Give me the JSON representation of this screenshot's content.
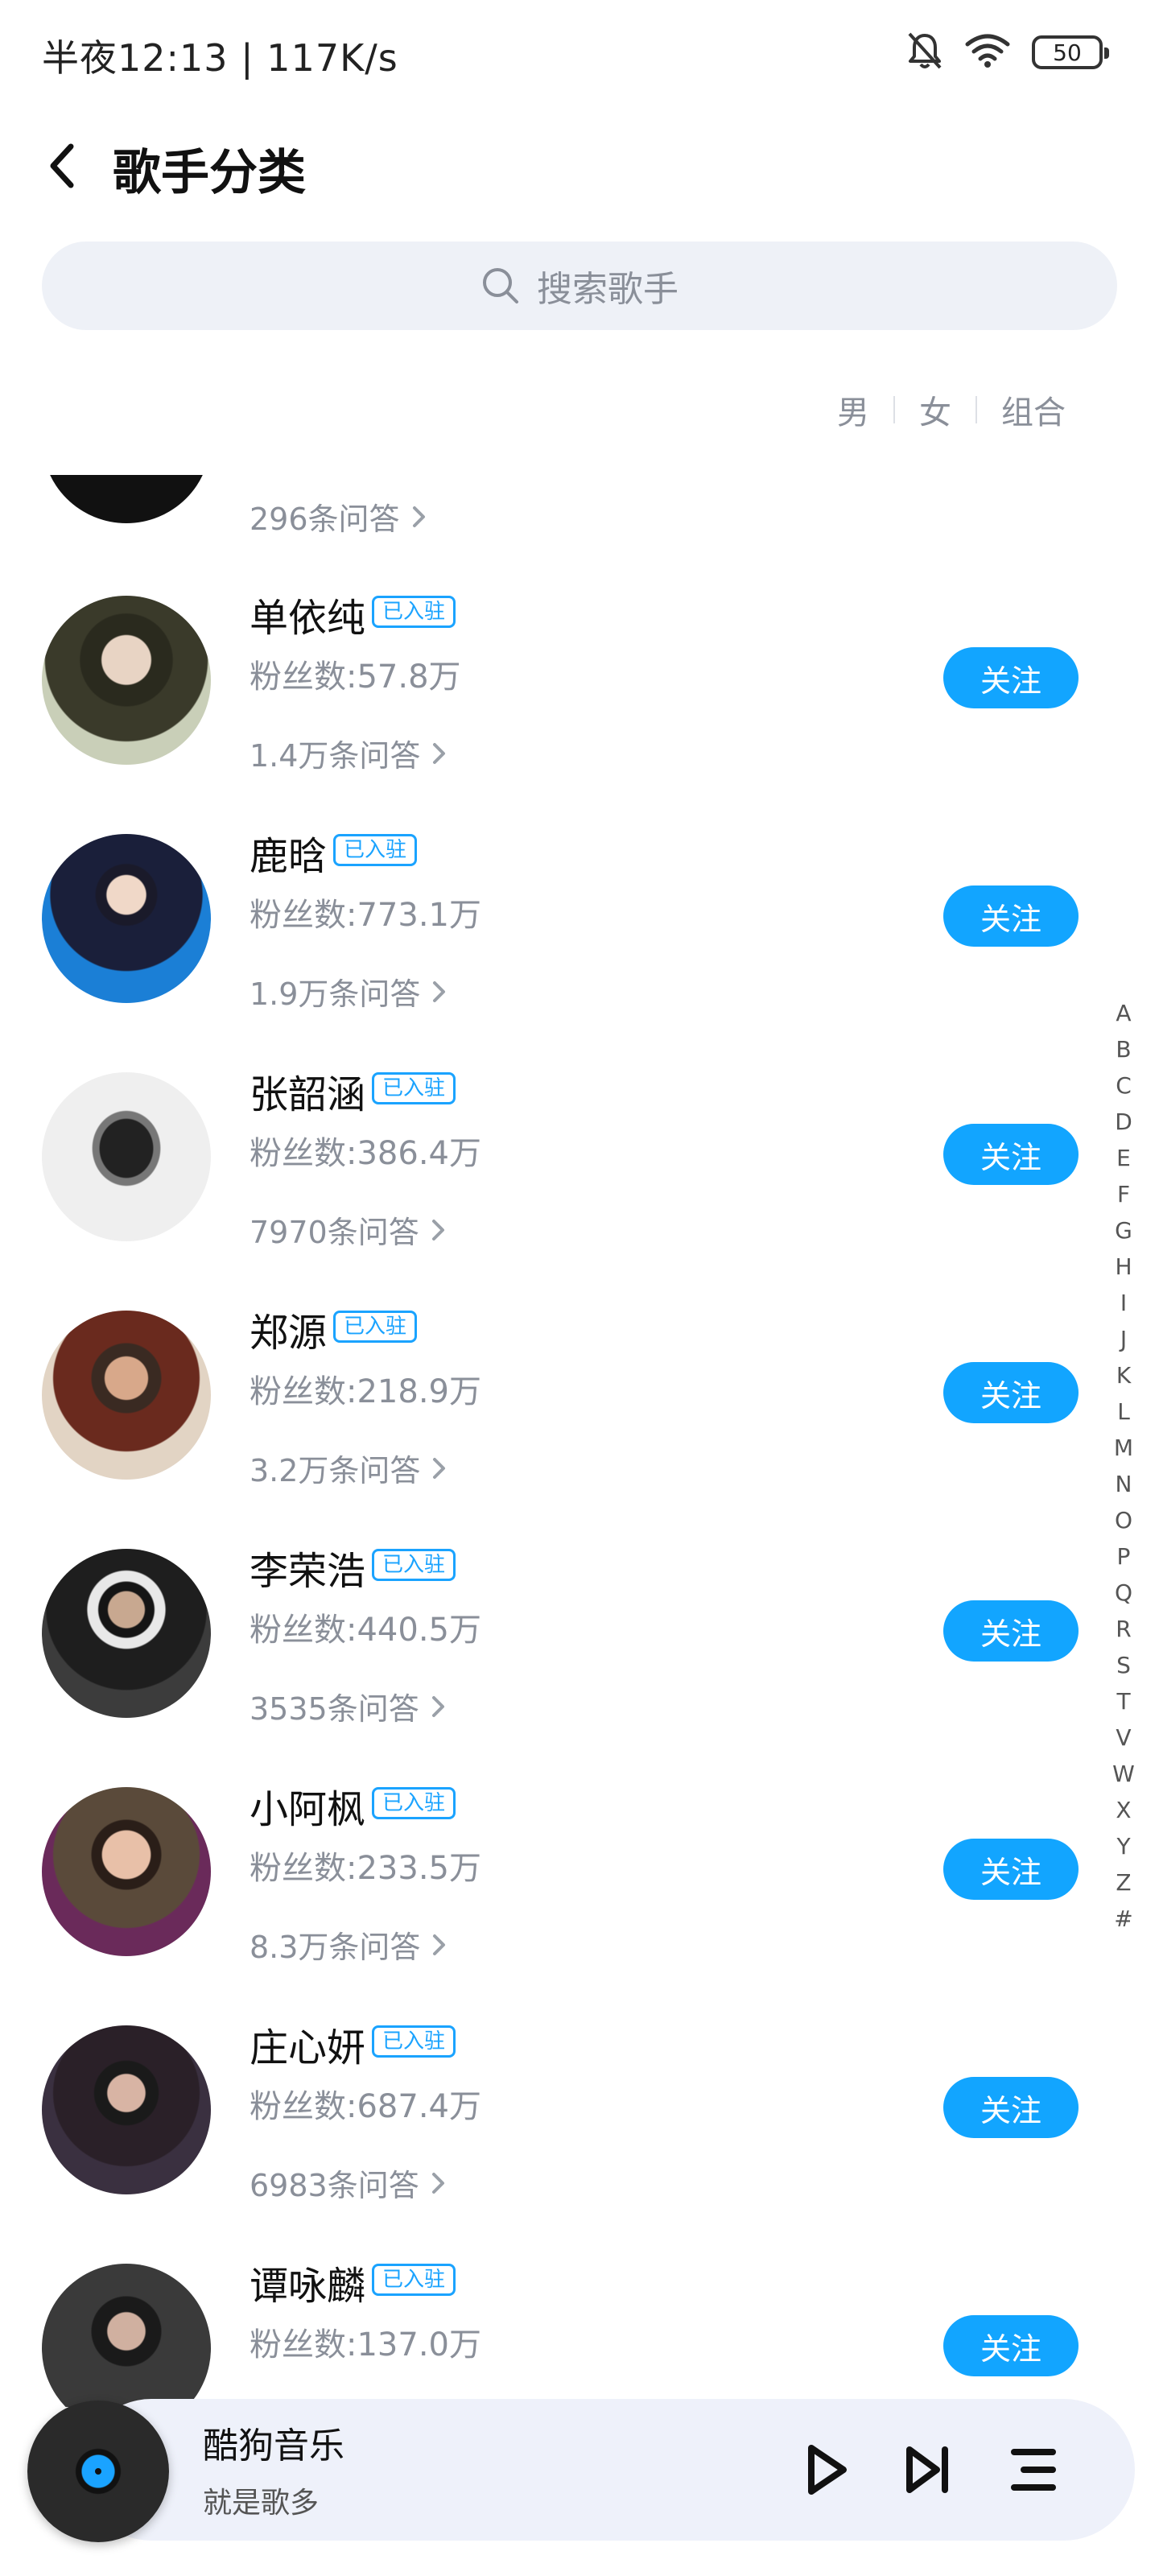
{
  "status": {
    "left": "半夜12:13 | 117K/s",
    "battery": "50"
  },
  "header": {
    "title": "歌手分类"
  },
  "search": {
    "placeholder": "搜索歌手"
  },
  "filters": [
    "男",
    "女",
    "组合"
  ],
  "partial_row": {
    "qa": "296条问答"
  },
  "badge_label": "已入驻",
  "follow_label": "关注",
  "artists": [
    {
      "name": "单依纯",
      "fans": "粉丝数:57.8万",
      "qa": "1.4万条问答"
    },
    {
      "name": "鹿晗",
      "fans": "粉丝数:773.1万",
      "qa": "1.9万条问答"
    },
    {
      "name": "张韶涵",
      "fans": "粉丝数:386.4万",
      "qa": "7970条问答"
    },
    {
      "name": "郑源",
      "fans": "粉丝数:218.9万",
      "qa": "3.2万条问答"
    },
    {
      "name": "李荣浩",
      "fans": "粉丝数:440.5万",
      "qa": "3535条问答"
    },
    {
      "name": "小阿枫",
      "fans": "粉丝数:233.5万",
      "qa": "8.3万条问答"
    },
    {
      "name": "庄心妍",
      "fans": "粉丝数:687.4万",
      "qa": "6983条问答"
    },
    {
      "name": "谭咏麟",
      "fans": "粉丝数:137.0万",
      "qa": ""
    }
  ],
  "alphabet": [
    "A",
    "B",
    "C",
    "D",
    "E",
    "F",
    "G",
    "H",
    "I",
    "J",
    "K",
    "L",
    "M",
    "N",
    "O",
    "P",
    "Q",
    "R",
    "S",
    "T",
    "V",
    "W",
    "X",
    "Y",
    "Z",
    "#"
  ],
  "player": {
    "title": "酷狗音乐",
    "subtitle": "就是歌多"
  },
  "colors": {
    "accent": "#12a5ff",
    "muted_text": "#8a8f99",
    "search_bg": "#eef1f7"
  }
}
